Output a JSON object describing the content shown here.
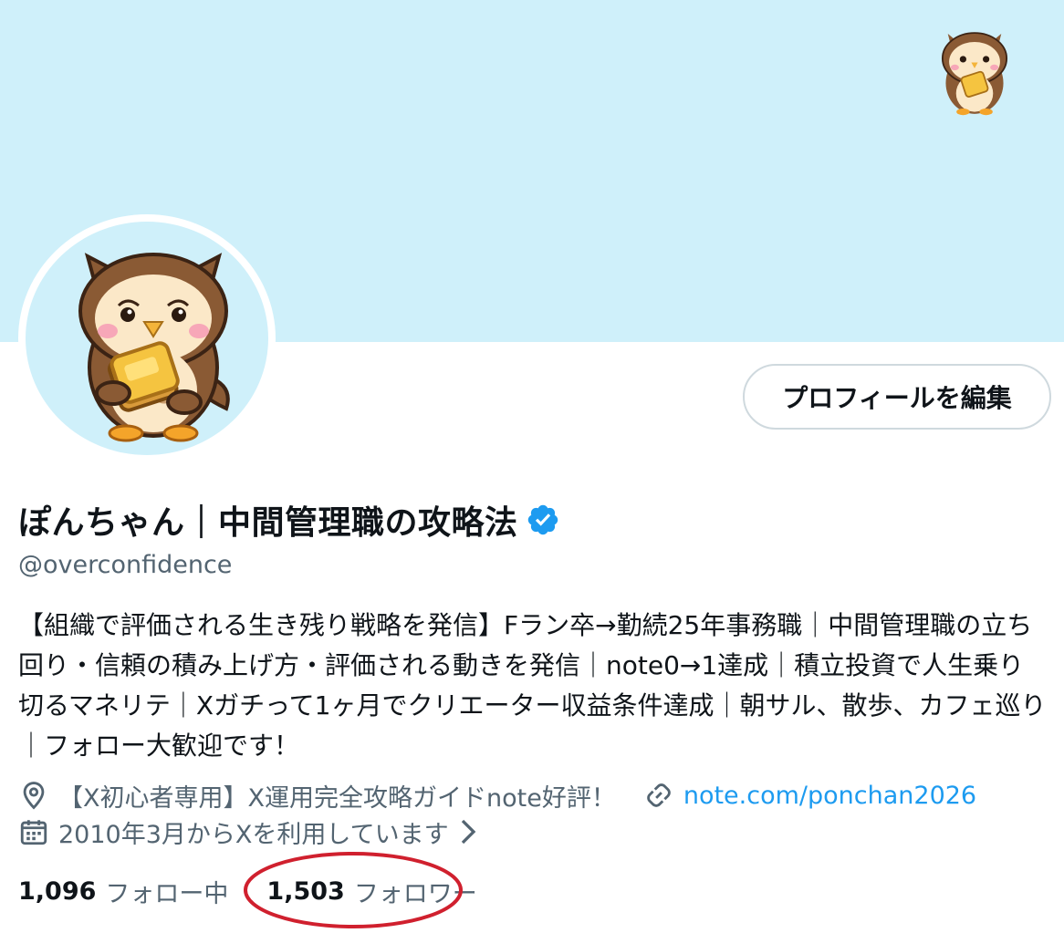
{
  "profile": {
    "display_name": "ぽんちゃん｜中間管理職の攻略法",
    "handle": "@overconfidence",
    "bio": "【組織で評価される生き残り戦略を発信】Fラン卒→勤続25年事務職｜中間管理職の立ち回り・信頼の積み上げ方・評価される動きを発信｜note0→1達成｜積立投資で人生乗り切るマネリテ｜Xガチって1ヶ月でクリエーター収益条件達成｜朝サル、散歩、カフェ巡り｜フォロー大歓迎です！",
    "location": "【X初心者専用】X運用完全攻略ガイドnote好評！",
    "website": "note.com/ponchan2026",
    "joined": "2010年3月からXを利用しています",
    "verified": true
  },
  "actions": {
    "edit_profile_label": "プロフィールを編集"
  },
  "stats": {
    "following_count": "1,096",
    "following_label": "フォロー中",
    "followers_count": "1,503",
    "followers_label": "フォロワー"
  },
  "colors": {
    "banner": "#cff0fa",
    "verified": "#1d9bf0",
    "link": "#1d9bf0",
    "secondary_text": "#536471",
    "highlight_circle": "#d0202e"
  },
  "icons": {
    "location": "location-pin-icon",
    "link": "link-icon",
    "calendar": "calendar-icon",
    "verified": "verified-badge-icon",
    "chevron": "chevron-right-icon"
  }
}
